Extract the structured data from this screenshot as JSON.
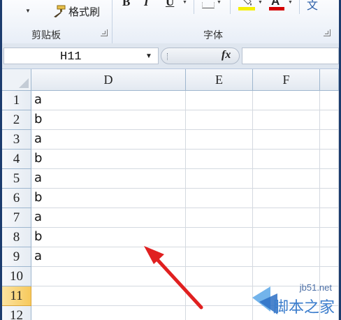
{
  "ribbon": {
    "format_painter_label": "格式刷",
    "clipboard_group_label": "剪贴板",
    "font_group_label": "字体",
    "bold_label": "B",
    "italic_label": "I",
    "underline_label": "U",
    "font_color_letter": "A",
    "char_label": "文",
    "fill_color": "#f5ef00",
    "font_color": "#d40000"
  },
  "formula_bar": {
    "name_box_value": "H11",
    "fx_label": "fx",
    "formula_value": ""
  },
  "grid": {
    "columns": [
      "D",
      "E",
      "F"
    ],
    "rows": [
      {
        "num": "1",
        "d": "a"
      },
      {
        "num": "2",
        "d": "b"
      },
      {
        "num": "3",
        "d": "a"
      },
      {
        "num": "4",
        "d": "b"
      },
      {
        "num": "5",
        "d": "a"
      },
      {
        "num": "6",
        "d": "b"
      },
      {
        "num": "7",
        "d": "a"
      },
      {
        "num": "8",
        "d": "b"
      },
      {
        "num": "9",
        "d": "a"
      },
      {
        "num": "10",
        "d": ""
      },
      {
        "num": "11",
        "d": ""
      },
      {
        "num": "12",
        "d": ""
      }
    ],
    "active_row": "11"
  },
  "watermark": {
    "url": "jb51.net",
    "name": "脚本之家"
  },
  "annotation": {
    "arrow_color": "#e02020"
  }
}
